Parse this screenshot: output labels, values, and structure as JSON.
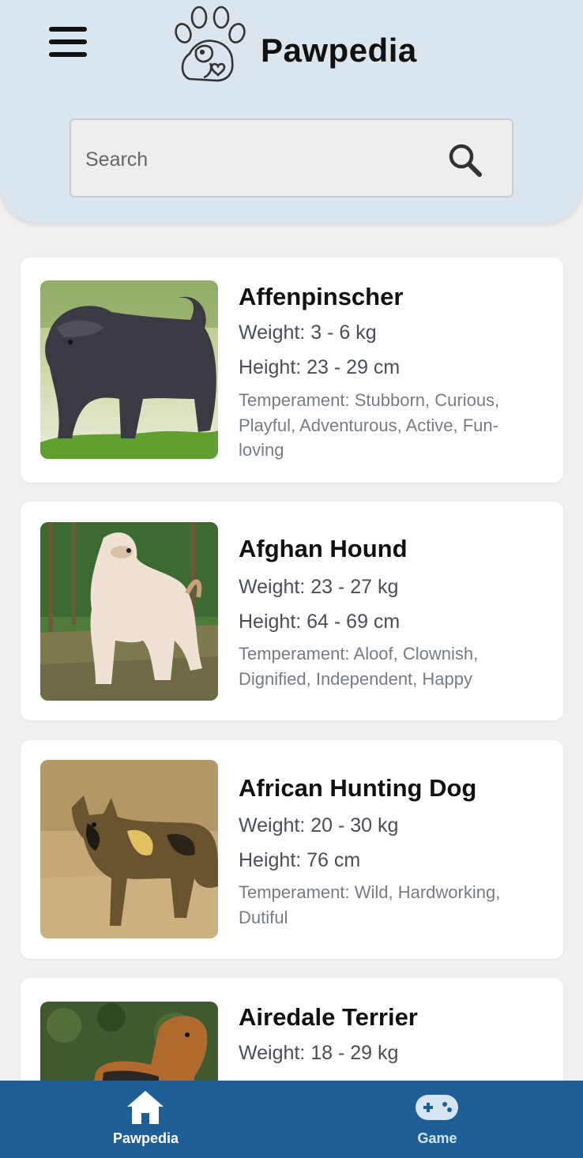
{
  "app": {
    "title": "Pawpedia"
  },
  "search": {
    "placeholder": "Search",
    "value": ""
  },
  "breeds": [
    {
      "name": "Affenpinscher",
      "weight": "Weight: 3 - 6 kg",
      "height": "Height: 23 - 29 cm",
      "temperament": "Temperament: Stubborn, Curious, Playful, Adventurous, Active, Fun-loving"
    },
    {
      "name": "Afghan Hound",
      "weight": "Weight: 23 - 27 kg",
      "height": "Height: 64 - 69 cm",
      "temperament": "Temperament: Aloof, Clownish, Dignified, Independent, Happy"
    },
    {
      "name": "African Hunting Dog",
      "weight": "Weight: 20 - 30 kg",
      "height": "Height: 76 cm",
      "temperament": "Temperament: Wild, Hardworking, Dutiful"
    },
    {
      "name": "Airedale Terrier",
      "weight": "Weight: 18 - 29 kg"
    }
  ],
  "nav": {
    "home": "Pawpedia",
    "game": "Game"
  },
  "colors": {
    "header": "#dbe5ed",
    "nav": "#1f5f97",
    "card": "#ffffff"
  }
}
